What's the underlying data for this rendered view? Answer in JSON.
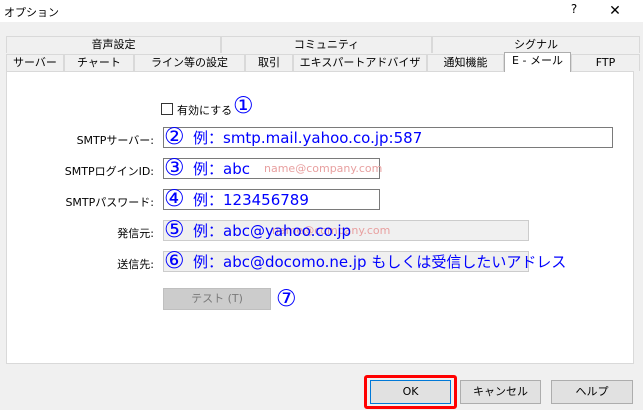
{
  "window": {
    "title": "オプション",
    "help_glyph": "?",
    "close_glyph": "✕"
  },
  "tabs": {
    "row1": [
      "音声設定",
      "コミュニティ",
      "シグナル"
    ],
    "row2": [
      "サーバー",
      "チャート",
      "ライン等の設定",
      "取引",
      "エキスパートアドバイザ",
      "通知機能",
      "E - メール",
      "FTP"
    ],
    "active": "E - メール"
  },
  "email": {
    "enable_label": "有効にする",
    "enabled": false,
    "smtp_server_label": "SMTPサーバー:",
    "smtp_login_label": "SMTPログインID:",
    "smtp_password_label": "SMTPパスワード:",
    "from_label": "発信元:",
    "to_label": "送信先:",
    "test_button": "テスト (T)",
    "smtp_login_placeholder": "name@company.com",
    "from_placeholder": "name@company.com"
  },
  "annotations": {
    "n1": "①",
    "n2": "②",
    "n3": "③",
    "n4": "④",
    "n5": "⑤",
    "n6": "⑥",
    "n7": "⑦",
    "hint_server": "例：smtp.mail.yahoo.co.jp:587",
    "hint_login": "例：abc",
    "hint_password": "例：123456789",
    "hint_from": "例：abc@yahoo.co.jp",
    "hint_to": "例：abc@docomo.ne.jp もしくは受信したいアドレス",
    "accent_color": "#0000ff",
    "highlight_color": "#ff0000"
  },
  "footer": {
    "ok": "OK",
    "cancel": "キャンセル",
    "help": "ヘルプ"
  }
}
